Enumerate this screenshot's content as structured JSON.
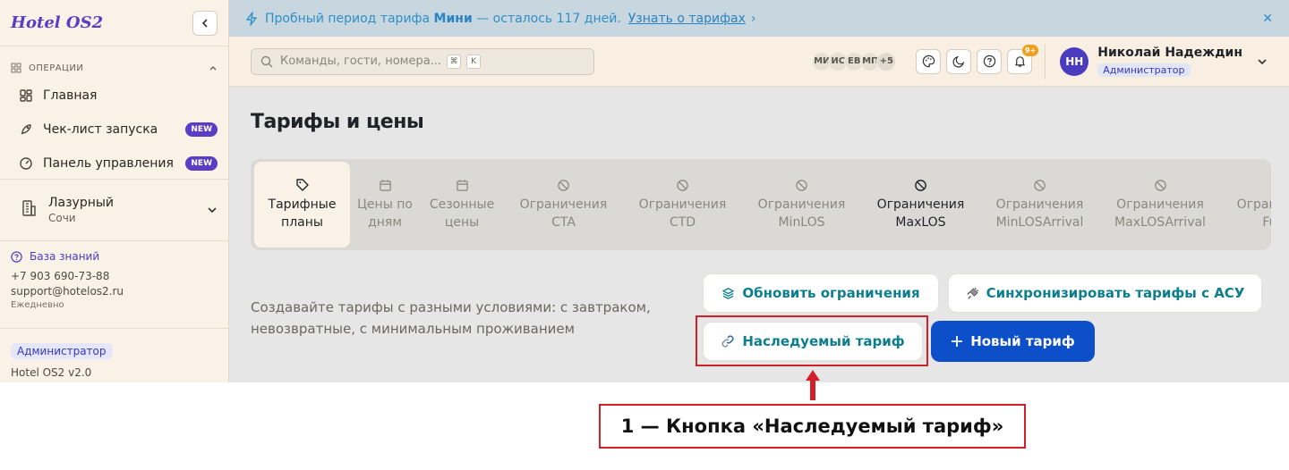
{
  "sidebar": {
    "logo": "Hotel OS2",
    "section_label": "ОПЕРАЦИИ",
    "items": [
      {
        "label": "Главная",
        "icon": "dashboard-icon"
      },
      {
        "label": "Чек-лист запуска",
        "icon": "rocket-icon",
        "badge": "NEW"
      },
      {
        "label": "Панель управления",
        "icon": "gauge-icon",
        "badge": "NEW"
      }
    ],
    "hotel": {
      "name": "Лазурный",
      "city": "Сочи"
    },
    "support": {
      "kb_label": "База знаний",
      "phone": "+7 903 690-73-88",
      "email": "support@hotelos2.ru",
      "schedule": "Ежедневно"
    },
    "role": "Администратор",
    "version": "Hotel OS2 v2.0"
  },
  "trial_banner": {
    "text_before": "Пробный период тарифа",
    "plan": "Мини",
    "text_after": "— осталось 117 дней.",
    "link": "Узнать о тарифах",
    "link_arrow": "›",
    "close": "✕"
  },
  "topbar": {
    "search_placeholder": "Команды, гости, номера...",
    "shortcut_keys": [
      "⌘",
      "K"
    ],
    "avatars": [
      "МИ",
      "ИС",
      "ЕВ",
      "МП",
      "+5"
    ],
    "notification_badge": "9+",
    "user": {
      "initials": "НН",
      "name": "Николай Надеждин",
      "role": "Администратор"
    }
  },
  "page": {
    "title": "Тарифы и цены",
    "tabs": [
      {
        "label": "Тарифные планы",
        "icon": "tag-icon"
      },
      {
        "label": "Цены по дням",
        "icon": "calendar-icon"
      },
      {
        "label": "Сезонные цены",
        "icon": "calendar-icon"
      },
      {
        "label": "Ограничения CTA",
        "icon": "ban-icon"
      },
      {
        "label": "Ограничения CTD",
        "icon": "ban-icon"
      },
      {
        "label": "Ограничения MinLOS",
        "icon": "ban-icon"
      },
      {
        "label": "Ограничения MaxLOS",
        "icon": "ban-icon"
      },
      {
        "label": "Ограничения MinLOSArrival",
        "icon": "ban-icon"
      },
      {
        "label": "Ограничения MaxLOSArrival",
        "icon": "ban-icon"
      },
      {
        "label": "Ограничения FullPa",
        "icon": "ban-icon"
      }
    ],
    "description": "Создавайте тарифы с разными условиями: с завтраком, невозвратные, с минимальным проживанием",
    "buttons": {
      "update_restrictions": "Обновить ограничения",
      "sync_tariffs": "Синхронизировать тарифы с АСУ",
      "inherited_tariff": "Наследуемый тариф",
      "new_tariff": "Новый тариф"
    }
  },
  "annotation": {
    "callout": "1 — Кнопка «Наследуемый тариф»",
    "color": "#d0202a"
  },
  "colors": {
    "brand": "#5b3cc4",
    "primary_button": "#0d4fc9",
    "accent_text": "#0d7e8e",
    "sidebar_bg": "#faf2e6",
    "trial_bg": "#c8d7df"
  }
}
